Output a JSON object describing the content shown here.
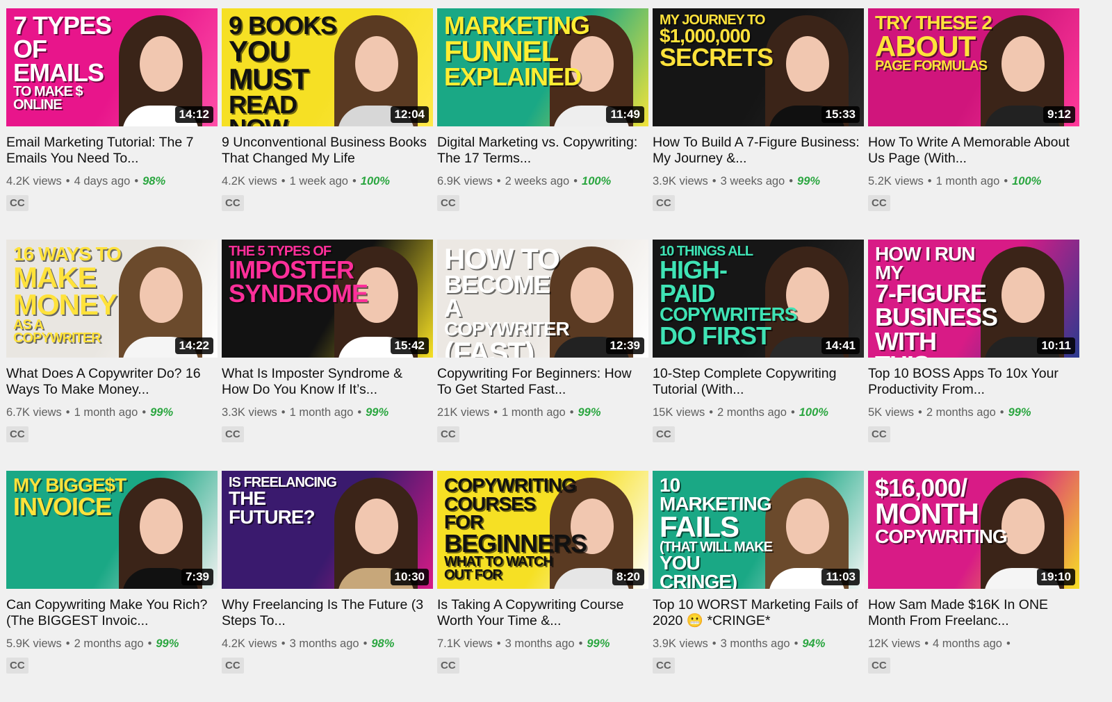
{
  "videos": [
    {
      "title": "Email Marketing Tutorial: The 7 Emails You Need To...",
      "views": "4.2K views",
      "age": "4 days ago",
      "rating": "98%",
      "duration": "14:12",
      "cc": "CC",
      "thumb_lines": [
        "7 TYPES",
        "OF EMAILS",
        "TO MAKE $ ONLINE"
      ],
      "bg": "#e8158b",
      "bg2": "#ff4fa8",
      "text_color": "#ffffff",
      "hair": "#3a2418",
      "shirt": "#ffffff"
    },
    {
      "title": "9 Unconventional Business Books That Changed My Life",
      "views": "4.2K views",
      "age": "1 week ago",
      "rating": "100%",
      "duration": "12:04",
      "cc": "CC",
      "thumb_lines": [
        "9 BOOKS",
        "YOU",
        "MUST",
        "READ NOW"
      ],
      "bg": "#f6e024",
      "bg2": "#ffe94a",
      "text_color": "#111111",
      "hair": "#5a3a22",
      "shirt": "#d7d7d7"
    },
    {
      "title": "Digital Marketing vs. Copywriting: The 17 Terms...",
      "views": "6.9K views",
      "age": "2 weeks ago",
      "rating": "100%",
      "duration": "11:49",
      "cc": "CC",
      "thumb_lines": [
        "MARKETING",
        "FUNNEL",
        "EXPLAINED"
      ],
      "bg": "#1aa885",
      "bg2": "#f3e33a",
      "text_color": "#ffee33",
      "hair": "#4a2c1a",
      "shirt": "#eeeeee"
    },
    {
      "title": "How To Build A 7-Figure Business: My Journey &...",
      "views": "3.9K views",
      "age": "3 weeks ago",
      "rating": "99%",
      "duration": "15:33",
      "cc": "CC",
      "thumb_lines": [
        "MY JOURNEY TO",
        "$1,000,000",
        "SECRETS"
      ],
      "bg": "#151515",
      "bg2": "#2a2a2a",
      "text_color": "#ffe23b",
      "hair": "#3b2418",
      "shirt": "#101010"
    },
    {
      "title": "How To Write A Memorable About Us Page (With...",
      "views": "5.2K views",
      "age": "1 month ago",
      "rating": "100%",
      "duration": "9:12",
      "cc": "CC",
      "thumb_lines": [
        "TRY THESE 2",
        "ABOUT",
        "PAGE FORMULAS"
      ],
      "bg": "#d0157c",
      "bg2": "#ff3a9a",
      "text_color": "#ffe23b",
      "hair": "#3b2418",
      "shirt": "#222222"
    },
    {
      "title": "What Does A Copywriter Do? 16 Ways To Make Money...",
      "views": "6.7K views",
      "age": "1 month ago",
      "rating": "99%",
      "duration": "14:22",
      "cc": "CC",
      "thumb_lines": [
        "16 WAYS TO",
        "MAKE",
        "MONEY",
        "AS A COPYWRITER"
      ],
      "bg": "#e9e6e1",
      "bg2": "#ffffff",
      "text_color": "#ffe23b",
      "hair": "#6b4a2c",
      "shirt": "#f5f5f5"
    },
    {
      "title": "What Is Imposter Syndrome & How Do You Know If It’s...",
      "views": "3.3K views",
      "age": "1 month ago",
      "rating": "99%",
      "duration": "15:42",
      "cc": "CC",
      "thumb_lines": [
        "THE 5 TYPES OF",
        "IMPOSTER",
        "SYNDROME"
      ],
      "bg": "#121212",
      "bg2": "#f6e024",
      "text_color": "#ff2f9a",
      "hair": "#3b2418",
      "shirt": "#ffffff"
    },
    {
      "title": "Copywriting For Beginners: How To Get Started Fast...",
      "views": "21K views",
      "age": "1 month ago",
      "rating": "99%",
      "duration": "12:39",
      "cc": "CC",
      "thumb_lines": [
        "HOW TO",
        "BECOME A",
        "COPYWRITER",
        "(FAST)"
      ],
      "bg": "#ece8e3",
      "bg2": "#ffffff",
      "text_color": "#ffffff",
      "hair": "#5a3a22",
      "shirt": "#222222"
    },
    {
      "title": "10-Step Complete Copywriting Tutorial (With...",
      "views": "15K views",
      "age": "2 months ago",
      "rating": "100%",
      "duration": "14:41",
      "cc": "CC",
      "thumb_lines": [
        "10 THINGS ALL",
        "HIGH-PAID",
        "COPYWRITERS",
        "DO FIRST"
      ],
      "bg": "#161616",
      "bg2": "#2b2b2b",
      "text_color": "#3fe3b5",
      "hair": "#3b2418",
      "shirt": "#2a2a2a"
    },
    {
      "title": "Top 10 BOSS Apps To 10x Your Productivity From...",
      "views": "5K views",
      "age": "2 months ago",
      "rating": "99%",
      "duration": "10:11",
      "cc": "CC",
      "thumb_lines": [
        "HOW I RUN MY",
        "7-FIGURE",
        "BUSINESS",
        "WITH THIS"
      ],
      "bg": "#d81b86",
      "bg2": "#2a3b8f",
      "text_color": "#ffffff",
      "hair": "#3b2418",
      "shirt": "#222222"
    },
    {
      "title": "Can Copywriting Make You Rich? (The BIGGEST Invoic...",
      "views": "5.9K views",
      "age": "2 months ago",
      "rating": "99%",
      "duration": "7:39",
      "cc": "CC",
      "thumb_lines": [
        "MY BIGGE$T",
        "INVOICE"
      ],
      "bg": "#1aa885",
      "bg2": "#f0f0f0",
      "text_color": "#ffe23b",
      "hair": "#3b2418",
      "shirt": "#111111"
    },
    {
      "title": "Why Freelancing Is The Future (3 Steps To...",
      "views": "4.2K views",
      "age": "3 months ago",
      "rating": "98%",
      "duration": "10:30",
      "cc": "CC",
      "thumb_lines": [
        "IS FREELANCING",
        "THE FUTURE?"
      ],
      "bg": "#3a1a6e",
      "bg2": "#d81b86",
      "text_color": "#ffffff",
      "hair": "#3b2418",
      "shirt": "#c7a77a"
    },
    {
      "title": "Is Taking A Copywriting Course Worth Your Time &...",
      "views": "7.1K views",
      "age": "3 months ago",
      "rating": "99%",
      "duration": "8:20",
      "cc": "CC",
      "thumb_lines": [
        "COPYWRITING",
        "COURSES FOR",
        "BEGINNERS",
        "WHAT TO WATCH OUT FOR"
      ],
      "bg": "#f6e024",
      "bg2": "#ffffff",
      "text_color": "#111111",
      "hair": "#5a3a22",
      "shirt": "#e6e6e6"
    },
    {
      "title": "Top 10 WORST Marketing Fails of 2020 😬  *CRINGE*",
      "views": "3.9K views",
      "age": "3 months ago",
      "rating": "94%",
      "duration": "11:03",
      "cc": "CC",
      "thumb_lines": [
        "10 MARKETING",
        "FAILS",
        "(THAT WILL MAKE",
        "YOU CRINGE)"
      ],
      "bg": "#1aa885",
      "bg2": "#f6f6f6",
      "text_color": "#ffffff",
      "hair": "#6b4a2c",
      "shirt": "#ffffff"
    },
    {
      "title": "How Sam Made $16K In ONE Month From Freelanc...",
      "views": "12K views",
      "age": "4 months ago",
      "rating": "",
      "duration": "19:10",
      "cc": "CC",
      "thumb_lines": [
        "$16,000/",
        "MONTH",
        "COPYWRITING"
      ],
      "bg": "#d81b86",
      "bg2": "#f6e024",
      "text_color": "#ffffff",
      "hair": "#3b2418",
      "shirt": "#f5f5f5"
    }
  ]
}
